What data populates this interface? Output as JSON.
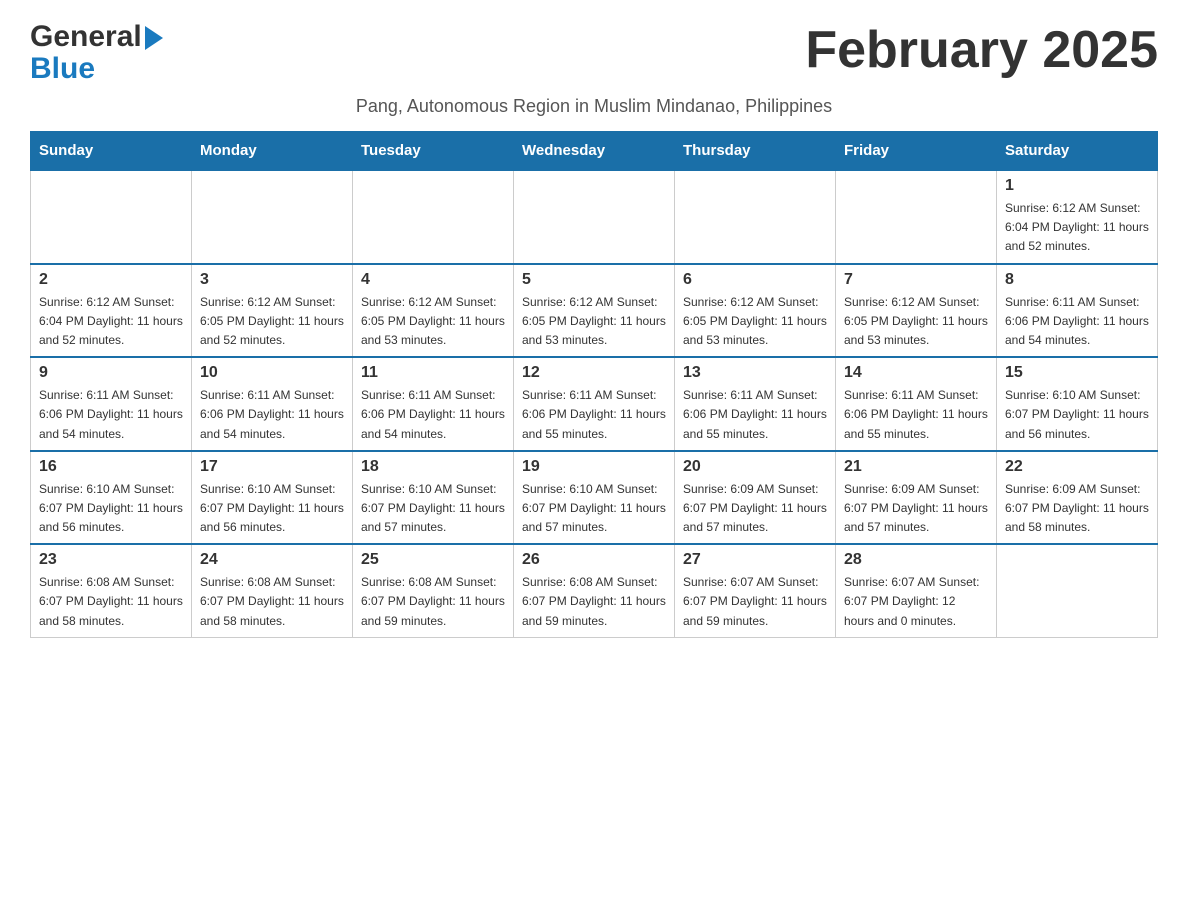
{
  "header": {
    "logo_general": "General",
    "logo_blue": "Blue",
    "month_title": "February 2025",
    "subtitle": "Pang, Autonomous Region in Muslim Mindanao, Philippines"
  },
  "days_of_week": [
    "Sunday",
    "Monday",
    "Tuesday",
    "Wednesday",
    "Thursday",
    "Friday",
    "Saturday"
  ],
  "weeks": [
    {
      "days": [
        {
          "number": "",
          "info": ""
        },
        {
          "number": "",
          "info": ""
        },
        {
          "number": "",
          "info": ""
        },
        {
          "number": "",
          "info": ""
        },
        {
          "number": "",
          "info": ""
        },
        {
          "number": "",
          "info": ""
        },
        {
          "number": "1",
          "info": "Sunrise: 6:12 AM\nSunset: 6:04 PM\nDaylight: 11 hours and 52 minutes."
        }
      ]
    },
    {
      "days": [
        {
          "number": "2",
          "info": "Sunrise: 6:12 AM\nSunset: 6:04 PM\nDaylight: 11 hours and 52 minutes."
        },
        {
          "number": "3",
          "info": "Sunrise: 6:12 AM\nSunset: 6:05 PM\nDaylight: 11 hours and 52 minutes."
        },
        {
          "number": "4",
          "info": "Sunrise: 6:12 AM\nSunset: 6:05 PM\nDaylight: 11 hours and 53 minutes."
        },
        {
          "number": "5",
          "info": "Sunrise: 6:12 AM\nSunset: 6:05 PM\nDaylight: 11 hours and 53 minutes."
        },
        {
          "number": "6",
          "info": "Sunrise: 6:12 AM\nSunset: 6:05 PM\nDaylight: 11 hours and 53 minutes."
        },
        {
          "number": "7",
          "info": "Sunrise: 6:12 AM\nSunset: 6:05 PM\nDaylight: 11 hours and 53 minutes."
        },
        {
          "number": "8",
          "info": "Sunrise: 6:11 AM\nSunset: 6:06 PM\nDaylight: 11 hours and 54 minutes."
        }
      ]
    },
    {
      "days": [
        {
          "number": "9",
          "info": "Sunrise: 6:11 AM\nSunset: 6:06 PM\nDaylight: 11 hours and 54 minutes."
        },
        {
          "number": "10",
          "info": "Sunrise: 6:11 AM\nSunset: 6:06 PM\nDaylight: 11 hours and 54 minutes."
        },
        {
          "number": "11",
          "info": "Sunrise: 6:11 AM\nSunset: 6:06 PM\nDaylight: 11 hours and 54 minutes."
        },
        {
          "number": "12",
          "info": "Sunrise: 6:11 AM\nSunset: 6:06 PM\nDaylight: 11 hours and 55 minutes."
        },
        {
          "number": "13",
          "info": "Sunrise: 6:11 AM\nSunset: 6:06 PM\nDaylight: 11 hours and 55 minutes."
        },
        {
          "number": "14",
          "info": "Sunrise: 6:11 AM\nSunset: 6:06 PM\nDaylight: 11 hours and 55 minutes."
        },
        {
          "number": "15",
          "info": "Sunrise: 6:10 AM\nSunset: 6:07 PM\nDaylight: 11 hours and 56 minutes."
        }
      ]
    },
    {
      "days": [
        {
          "number": "16",
          "info": "Sunrise: 6:10 AM\nSunset: 6:07 PM\nDaylight: 11 hours and 56 minutes."
        },
        {
          "number": "17",
          "info": "Sunrise: 6:10 AM\nSunset: 6:07 PM\nDaylight: 11 hours and 56 minutes."
        },
        {
          "number": "18",
          "info": "Sunrise: 6:10 AM\nSunset: 6:07 PM\nDaylight: 11 hours and 57 minutes."
        },
        {
          "number": "19",
          "info": "Sunrise: 6:10 AM\nSunset: 6:07 PM\nDaylight: 11 hours and 57 minutes."
        },
        {
          "number": "20",
          "info": "Sunrise: 6:09 AM\nSunset: 6:07 PM\nDaylight: 11 hours and 57 minutes."
        },
        {
          "number": "21",
          "info": "Sunrise: 6:09 AM\nSunset: 6:07 PM\nDaylight: 11 hours and 57 minutes."
        },
        {
          "number": "22",
          "info": "Sunrise: 6:09 AM\nSunset: 6:07 PM\nDaylight: 11 hours and 58 minutes."
        }
      ]
    },
    {
      "days": [
        {
          "number": "23",
          "info": "Sunrise: 6:08 AM\nSunset: 6:07 PM\nDaylight: 11 hours and 58 minutes."
        },
        {
          "number": "24",
          "info": "Sunrise: 6:08 AM\nSunset: 6:07 PM\nDaylight: 11 hours and 58 minutes."
        },
        {
          "number": "25",
          "info": "Sunrise: 6:08 AM\nSunset: 6:07 PM\nDaylight: 11 hours and 59 minutes."
        },
        {
          "number": "26",
          "info": "Sunrise: 6:08 AM\nSunset: 6:07 PM\nDaylight: 11 hours and 59 minutes."
        },
        {
          "number": "27",
          "info": "Sunrise: 6:07 AM\nSunset: 6:07 PM\nDaylight: 11 hours and 59 minutes."
        },
        {
          "number": "28",
          "info": "Sunrise: 6:07 AM\nSunset: 6:07 PM\nDaylight: 12 hours and 0 minutes."
        },
        {
          "number": "",
          "info": ""
        }
      ]
    }
  ]
}
